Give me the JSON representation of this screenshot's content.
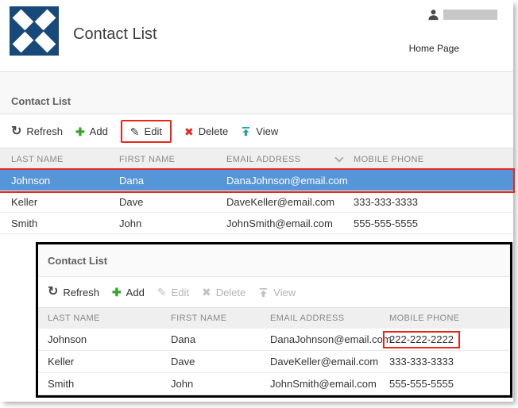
{
  "colors": {
    "logo_blue": "#17497a",
    "selected_row_blue": "#5596d8",
    "annotation_red": "#e8261d",
    "add_green": "#38a32f",
    "delete_red": "#df291e",
    "view_teal": "#2ba0a0"
  },
  "icons": {
    "refresh": "↻",
    "add": "✚",
    "edit": "✎",
    "delete": "✖"
  },
  "header": {
    "app_title": "Contact List",
    "home_link": "Home Page",
    "username_redacted": true
  },
  "main_module": {
    "title": "Contact List",
    "toolbar": [
      {
        "label": "Refresh",
        "enabled": true
      },
      {
        "label": "Add",
        "enabled": true
      },
      {
        "label": "Edit",
        "enabled": true,
        "annotated": true
      },
      {
        "label": "Delete",
        "enabled": true
      },
      {
        "label": "View",
        "enabled": true
      }
    ],
    "columns": [
      "LAST NAME",
      "FIRST NAME",
      "EMAIL ADDRESS",
      "MOBILE PHONE"
    ],
    "sorted_column": "EMAIL ADDRESS",
    "rows": [
      {
        "last_name": "Johnson",
        "first_name": "Dana",
        "email": "DanaJohnson@email.com",
        "mobile_phone": "",
        "selected": true,
        "annotated": true
      },
      {
        "last_name": "Keller",
        "first_name": "Dave",
        "email": "DaveKeller@email.com",
        "mobile_phone": "333-333-3333",
        "selected": false
      },
      {
        "last_name": "Smith",
        "first_name": "John",
        "email": "JohnSmith@email.com",
        "mobile_phone": "555-555-5555",
        "selected": false
      }
    ]
  },
  "inset_module": {
    "title": "Contact List",
    "toolbar": [
      {
        "label": "Refresh",
        "enabled": true
      },
      {
        "label": "Add",
        "enabled": true
      },
      {
        "label": "Edit",
        "enabled": false
      },
      {
        "label": "Delete",
        "enabled": false
      },
      {
        "label": "View",
        "enabled": false
      }
    ],
    "columns": [
      "LAST NAME",
      "FIRST NAME",
      "EMAIL ADDRESS",
      "MOBILE PHONE"
    ],
    "rows": [
      {
        "last_name": "Johnson",
        "first_name": "Dana",
        "email": "DanaJohnson@email.com",
        "mobile_phone": "222-222-2222",
        "phone_annotated": true
      },
      {
        "last_name": "Keller",
        "first_name": "Dave",
        "email": "DaveKeller@email.com",
        "mobile_phone": "333-333-3333"
      },
      {
        "last_name": "Smith",
        "first_name": "John",
        "email": "JohnSmith@email.com",
        "mobile_phone": "555-555-5555"
      }
    ]
  }
}
